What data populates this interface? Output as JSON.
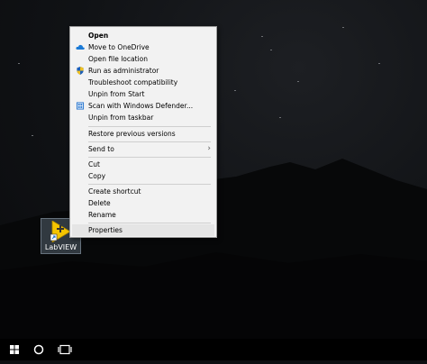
{
  "desktop": {
    "icon": {
      "name": "LabVIEW",
      "icon": "labview-icon"
    }
  },
  "context_menu": {
    "items": [
      {
        "label": "Open",
        "bold": true
      },
      {
        "label": "Move to OneDrive",
        "icon": "onedrive-icon"
      },
      {
        "label": "Open file location"
      },
      {
        "label": "Run as administrator",
        "icon": "uac-shield-icon"
      },
      {
        "label": "Troubleshoot compatibility"
      },
      {
        "label": "Unpin from Start"
      },
      {
        "label": "Scan with Windows Defender...",
        "icon": "windows-defender-icon"
      },
      {
        "label": "Unpin from taskbar"
      },
      {
        "label": "Restore previous versions"
      },
      {
        "label": "Send to",
        "submenu": true
      },
      {
        "label": "Cut"
      },
      {
        "label": "Copy"
      },
      {
        "label": "Create shortcut"
      },
      {
        "label": "Delete"
      },
      {
        "label": "Rename"
      },
      {
        "label": "Properties",
        "highlighted": true
      }
    ]
  },
  "taskbar": {
    "buttons": [
      {
        "icon": "windows-start-icon"
      },
      {
        "icon": "cortana-search-icon"
      },
      {
        "icon": "task-view-icon"
      }
    ]
  },
  "colors": {
    "menu_background": "#f2f2f2",
    "menu_hover": "#e5e5e5",
    "taskbar": "#000000",
    "onedrive_blue": "#1b7ad6",
    "labview_yellow": "#f5c400"
  }
}
